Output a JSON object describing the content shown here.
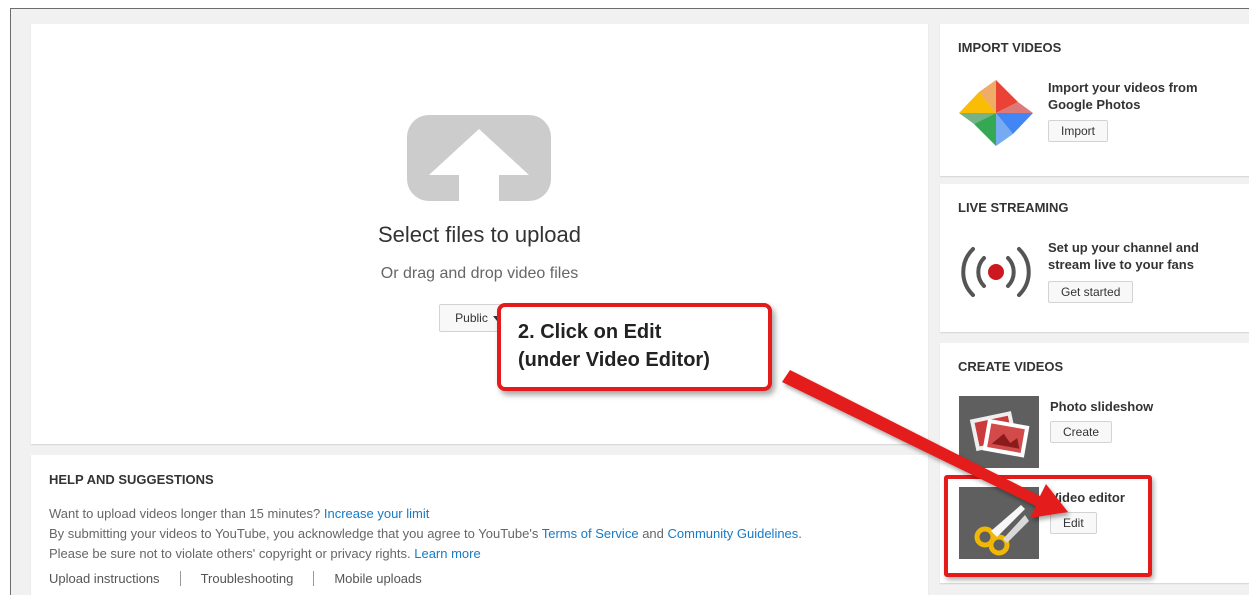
{
  "upload": {
    "title": "Select files to upload",
    "subtitle": "Or drag and drop video files",
    "privacy_label": "Public"
  },
  "help": {
    "title": "HELP AND SUGGESTIONS",
    "line1_text": "Want to upload videos longer than 15 minutes?",
    "line1_link": "Increase your limit",
    "line2_text_a": "By submitting your videos to YouTube, you acknowledge that you agree to YouTube's",
    "line2_link_tos": "Terms of Service",
    "line2_text_b": "and",
    "line2_link_guidelines": "Community Guidelines",
    "line2_text_c": ".",
    "line3_text": "Please be sure not to violate others' copyright or privacy rights.",
    "line3_link": "Learn more",
    "links": [
      "Upload instructions",
      "Troubleshooting",
      "Mobile uploads"
    ]
  },
  "import_videos": {
    "title": "IMPORT VIDEOS",
    "description": "Import your videos from Google Photos",
    "button": "Import",
    "icon": "google-photos-icon"
  },
  "live_streaming": {
    "title": "LIVE STREAMING",
    "description": "Set up your channel and stream live to your fans",
    "button": "Get started",
    "icon": "live-broadcast-icon"
  },
  "create_videos": {
    "title": "CREATE VIDEOS",
    "items": [
      {
        "label": "Photo slideshow",
        "button": "Create",
        "icon": "photo-slideshow-icon"
      },
      {
        "label": "Video editor",
        "button": "Edit",
        "icon": "scissors-icon"
      }
    ]
  },
  "annotation": {
    "line1": "2. Click on Edit",
    "line2": "(under Video Editor)",
    "color": "#e51a1a"
  },
  "colors": {
    "link": "#167ac6",
    "background": "#f1f1f1"
  }
}
